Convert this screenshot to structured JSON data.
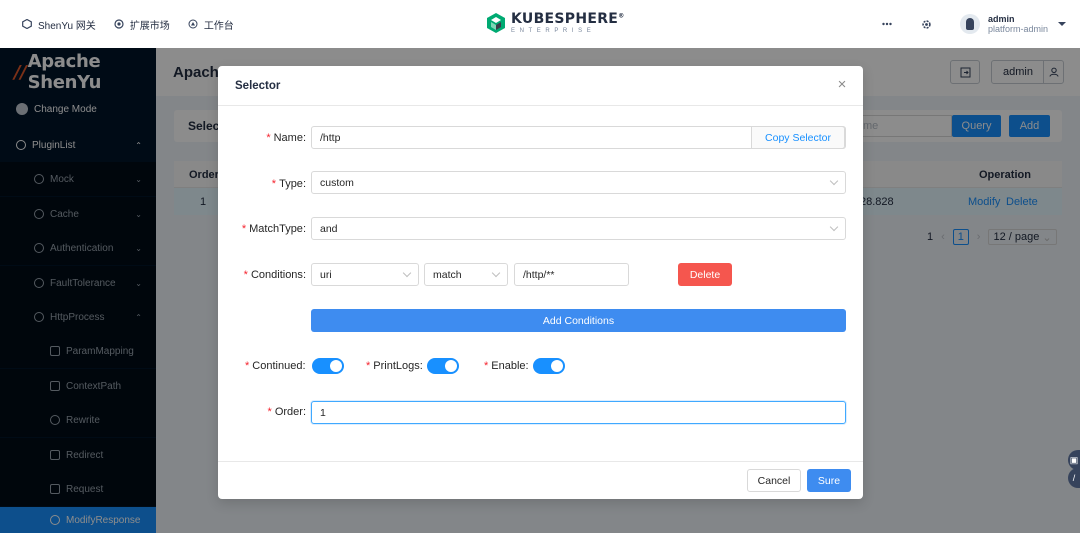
{
  "topbar": {
    "nav": [
      {
        "label": "ShenYu 网关",
        "icon": "gateway-icon"
      },
      {
        "label": "扩展市场",
        "icon": "extension-icon"
      },
      {
        "label": "工作台",
        "icon": "workbench-icon"
      }
    ],
    "logo_main": "KUBESPHERE",
    "logo_reg": "®",
    "logo_sub": "ENTERPRISE",
    "user_name": "admin",
    "user_role": "platform-admin"
  },
  "sidebar": {
    "brand": "Apache ShenYu",
    "items": [
      {
        "label": "Change Mode",
        "icon": "circle-dot-icon"
      },
      {
        "label": "PluginList",
        "icon": "plugin-icon",
        "chevron": "^"
      },
      {
        "label": "Mock",
        "icon": "plugin-icon",
        "chevron": "v"
      },
      {
        "label": "Cache",
        "icon": "plugin-icon",
        "chevron": "v"
      },
      {
        "label": "Authentication",
        "icon": "plugin-icon",
        "chevron": "v"
      },
      {
        "label": "FaultTolerance",
        "icon": "plugin-icon",
        "chevron": "v"
      },
      {
        "label": "HttpProcess",
        "icon": "plugin-icon",
        "chevron": "^"
      },
      {
        "label": "ParamMapping",
        "icon": "param-icon"
      },
      {
        "label": "ContextPath",
        "icon": "context-icon"
      },
      {
        "label": "Rewrite",
        "icon": "rewrite-icon"
      },
      {
        "label": "Redirect",
        "icon": "redirect-icon"
      },
      {
        "label": "Request",
        "icon": "request-icon"
      },
      {
        "label": "ModifyResponse",
        "icon": "modify-icon"
      }
    ]
  },
  "page": {
    "title": "Apach",
    "user_button": "admin",
    "card_title": "Selec",
    "search_placeholder": "me",
    "query_label": "Query",
    "add_label": "Add",
    "table": {
      "headers": {
        "order": "Order",
        "operation": "Operation"
      },
      "row": {
        "order": "1",
        "value": "28.828",
        "modify": "Modify",
        "delete": "Delete"
      }
    },
    "pager": {
      "current": "1",
      "prev_label": "1",
      "size": "12 / page"
    }
  },
  "modal": {
    "title": "Selector",
    "close": "×",
    "name": {
      "label": "Name",
      "value": "/http",
      "addon": "Copy Selector"
    },
    "type": {
      "label": "Type",
      "value": "custom"
    },
    "match_type": {
      "label": "MatchType",
      "value": "and"
    },
    "conditions": {
      "label": "Conditions",
      "param_type": "uri",
      "operator": "match",
      "value": "/http/**",
      "delete_label": "Delete"
    },
    "add_conditions_label": "Add Conditions",
    "continued": {
      "label": "Continued",
      "on": true
    },
    "print_logs": {
      "label": "PrintLogs",
      "on": true
    },
    "enable": {
      "label": "Enable",
      "on": true
    },
    "order": {
      "label": "Order",
      "value": "1"
    },
    "cancel_label": "Cancel",
    "sure_label": "Sure"
  },
  "colors": {
    "primary": "#1890ff",
    "danger": "#f5564e",
    "sidebar": "#001529"
  }
}
